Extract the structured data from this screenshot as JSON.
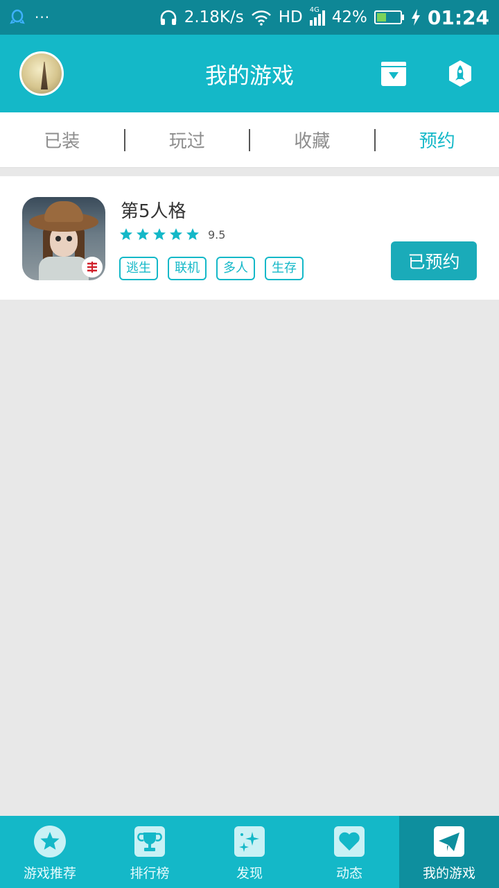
{
  "status_bar": {
    "network_speed": "2.18K/s",
    "hd_label": "HD",
    "network_type": "4G",
    "battery": "42%",
    "battery_level": 0.42,
    "time": "01:24",
    "icons": [
      "qq-icon",
      "more-dots-icon",
      "headphones-icon",
      "wifi-icon",
      "signal-icon",
      "battery-icon",
      "charging-icon"
    ]
  },
  "header": {
    "title": "我的游戏",
    "icons": [
      "avatar",
      "download-box-icon",
      "rocket-icon"
    ]
  },
  "tabs": [
    {
      "label": "已装",
      "active": false
    },
    {
      "label": "玩过",
      "active": false
    },
    {
      "label": "收藏",
      "active": false
    },
    {
      "label": "预约",
      "active": true
    }
  ],
  "games": [
    {
      "name": "第5人格",
      "stars": 5,
      "score": "9.5",
      "tags": [
        "逃生",
        "联机",
        "多人",
        "生存"
      ],
      "action_label": "已预约"
    }
  ],
  "bottom_nav": [
    {
      "label": "游戏推荐",
      "icon": "star-icon",
      "active": false
    },
    {
      "label": "排行榜",
      "icon": "trophy-icon",
      "active": false
    },
    {
      "label": "发现",
      "icon": "sparkle-icon",
      "active": false
    },
    {
      "label": "动态",
      "icon": "heart-icon",
      "active": false
    },
    {
      "label": "我的游戏",
      "icon": "paper-plane-icon",
      "active": true
    }
  ],
  "colors": {
    "primary": "#14b8c8",
    "status_bar": "#0e8796",
    "nav_active": "#0e8f9e",
    "button": "#1aabb9",
    "background": "#e8e8e8"
  }
}
